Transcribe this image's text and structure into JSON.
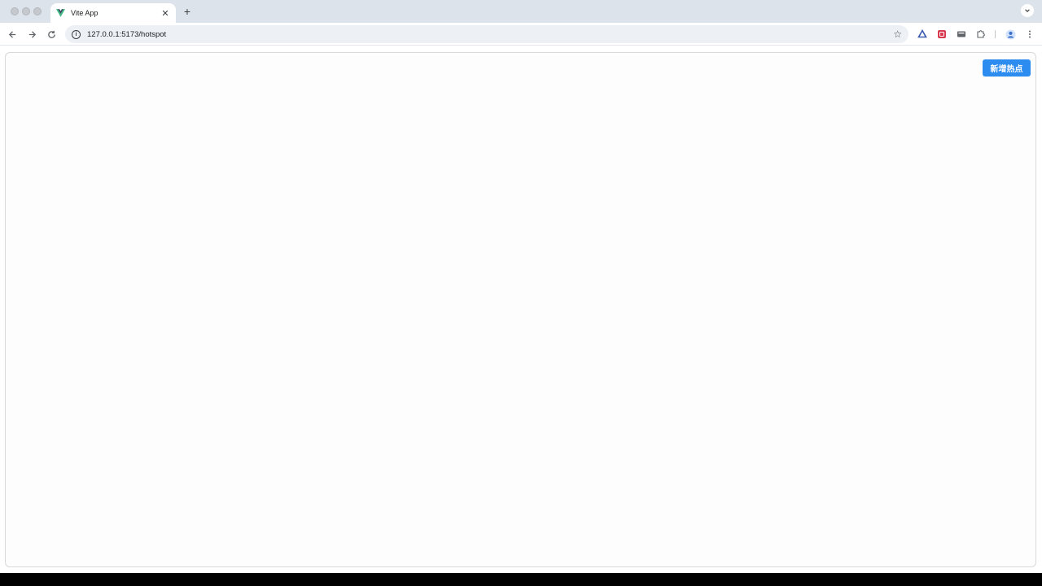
{
  "browser": {
    "tab": {
      "title": "Vite App",
      "favicon": "vue-logo-icon",
      "close_glyph": "✕"
    },
    "new_tab_glyph": "+",
    "address_bar": {
      "url": "127.0.0.1:5173/hotspot"
    }
  },
  "page": {
    "add_hotspot_button": "新增热点"
  },
  "colors": {
    "primary_button": "#2d8cf0",
    "vue_green": "#42b883",
    "vue_dark": "#35495e"
  }
}
